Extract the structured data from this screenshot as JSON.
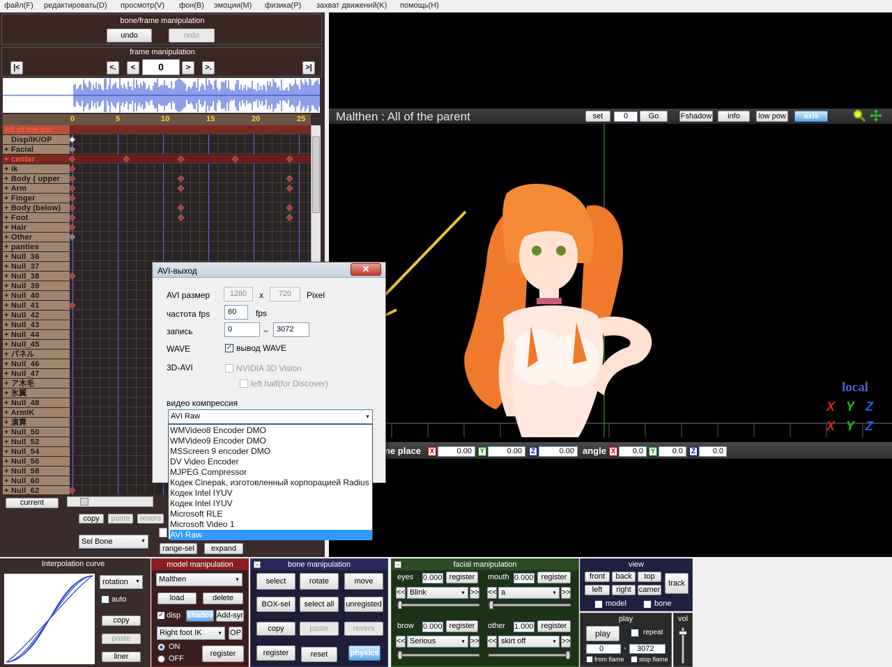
{
  "menu": [
    "файл(F)",
    "редактировать(D)",
    "просмотр(V)",
    "фон(B)",
    "эмоции(M)",
    "физика(P)",
    "захват движений(K)",
    "помощь(H)"
  ],
  "bone_frame": {
    "title": "bone/frame manipulation",
    "undo": "undo",
    "redo": "redo"
  },
  "frame_manip": {
    "title": "frame manipulation",
    "frame": "0",
    "first": "|<",
    "prev_key": "<.",
    "prev": "<",
    "next": ">",
    "next_key": ">.",
    "last": ">|"
  },
  "timeline": {
    "ticks": [
      "0",
      "5",
      "10",
      "15",
      "20",
      "25"
    ],
    "tracks": [
      "All of the par",
      "Disp/IK/OP",
      "+ Facial",
      "+ center",
      "+ ik",
      "+ Body ( upper",
      "+ Arm",
      "+ Finger",
      "+ Body (below)",
      "+ Foot",
      "+ Hair",
      "+ Other",
      "+ panties",
      "+ Null_36",
      "+ Null_37",
      "+ Null_38",
      "+ Null_39",
      "+ Null_40",
      "+ Null_41",
      "+ Null_42",
      "+ Null_43",
      "+ Null_44",
      "+ Null_45",
      "+ パネル",
      "+ Null_46",
      "+ Null_47",
      "+ ア木毛",
      "+ 氷翼",
      "+ Null_48",
      "+ ArmIK",
      "+ 演算",
      "+ Null_50",
      "+ Null_52",
      "+ Null_54",
      "+ Null_56",
      "+ Null_58",
      "+ Null_60",
      "+ Null_62"
    ],
    "current": "current",
    "copy": "copy",
    "paste": "paste",
    "revers": "revers",
    "sel_bone": "Sel Bone",
    "range_sel": "range-sel",
    "expand": "expand"
  },
  "viewport": {
    "model_title": "Malthen : All of the parent",
    "set": "set",
    "frame": "0",
    "go": "Go",
    "fshadow": "Fshadow",
    "info": "info",
    "low_pow": "low pow",
    "axis": "axis",
    "local": "local",
    "place_label": "ne place",
    "angle_label": "angle",
    "place": {
      "x": "0.00",
      "y": "0.00",
      "z": "0.00"
    },
    "angle": {
      "x": "0.0",
      "y": "0.0",
      "z": "0.0"
    },
    "axis_letters": {
      "x": "X",
      "y": "Y",
      "z": "Z"
    }
  },
  "dialog": {
    "title": "AVI-выход",
    "size_label": "AVI размер",
    "width": "1280",
    "x": "x",
    "height": "720",
    "pixel": "Pixel",
    "fps_label": "частота fps",
    "fps": "60",
    "fps_unit": "fps",
    "record_label": "запись",
    "record_from": "0",
    "tilde": "~",
    "record_to": "3072",
    "wave_label": "WAVE",
    "wave_check": "вывод WAVE",
    "avi3d_label": "3D-AVI",
    "nvidia": "NVIDIA 3D Vision",
    "left_half": "left half(for Discover)",
    "compress_label": "видео компрессия",
    "compress_value": "AVI Raw",
    "options": [
      "WMVideo8 Encoder DMO",
      "WMVideo9 Encoder DMO",
      "MSScreen 9 encoder DMO",
      "DV Video Encoder",
      "MJPEG Compressor",
      "Кодек Cinepak, изготовленный корпорацией Radius",
      "Кодек Intel IYUV",
      "Кодек Intel IYUV",
      "Microsoft RLE",
      "Microsoft Video 1",
      "AVI Raw"
    ]
  },
  "interp": {
    "title": "Interpolation curve",
    "mode": "rotation",
    "auto": "auto",
    "copy": "copy",
    "paste": "paste",
    "liner": "liner"
  },
  "model_manip": {
    "title": "model manipulation",
    "model": "Malthen",
    "load": "load",
    "delete": "delete",
    "disp": "disp",
    "shadow": "shadow",
    "addsyn": "Add-syn",
    "ik": "Right foot IK",
    "op": "OP",
    "on": "ON",
    "off": "OFF",
    "register": "register"
  },
  "bone_manip": {
    "title": "bone manipulation",
    "select": "select",
    "rotate": "rotate",
    "move": "move",
    "box_sel": "BOX-sel",
    "select_all": "select all",
    "unregisted": "unregisted",
    "copy": "copy",
    "paste": "paste",
    "revers": "revers",
    "register": "register",
    "reset": "reset",
    "physics": "physics"
  },
  "facial": {
    "title": "facial manipulation",
    "eyes": "eyes",
    "eyes_val": "0.000",
    "mouth": "mouth",
    "mouth_val": "0.000",
    "register": "register",
    "eyes_sel": "Blink",
    "mouth_sel": "a",
    "brow": "brow",
    "brow_val": "0.000",
    "other": "other",
    "other_val": "1.000",
    "brow_sel": "Serious",
    "other_sel": "skirt off",
    "prev": "<<",
    "next": ">>"
  },
  "view": {
    "title": "view",
    "front": "front",
    "back": "back",
    "top": "top",
    "track": "track",
    "left": "left",
    "right": "right",
    "camera": "camer",
    "model": "model",
    "bone": "bone"
  },
  "play": {
    "title": "play",
    "play": "play",
    "repeat": "repeat",
    "from": "0",
    "dash": "-",
    "to": "3072",
    "from_flame": "from flame",
    "stop_flame": "stop flame"
  },
  "vol": {
    "title": "vol"
  }
}
